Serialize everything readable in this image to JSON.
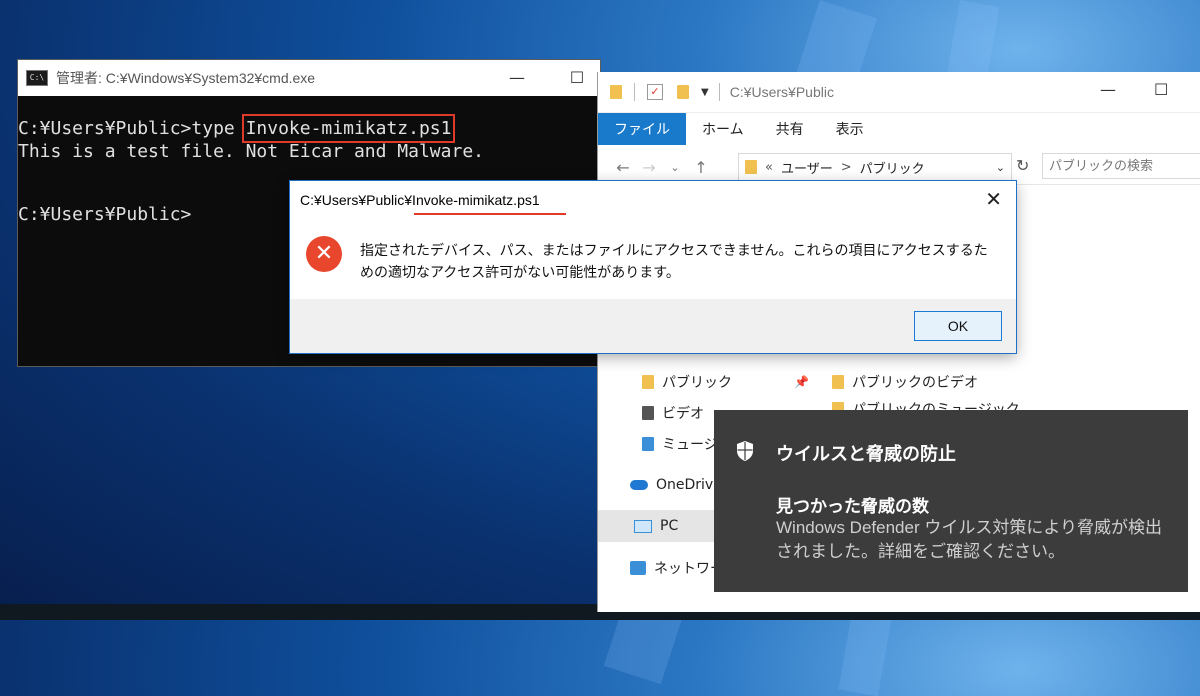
{
  "cmd": {
    "title": "管理者: C:¥Windows¥System32¥cmd.exe",
    "icon": "C:\\",
    "prompt1": "C:¥Users¥Public>type ",
    "command_arg": "Invoke-mimikatz.ps1",
    "output": "This is a test file. Not Eicar and Malware.",
    "prompt2": "C:¥Users¥Public>"
  },
  "explorer": {
    "title": "C:¥Users¥Public",
    "tabs": [
      "ファイル",
      "ホーム",
      "共有",
      "表示"
    ],
    "address": [
      "«",
      "ユーザー",
      ">",
      "パブリック"
    ],
    "search_placeholder": "パブリックの検索",
    "nav_items": [
      {
        "label": "パブリック"
      },
      {
        "label": "ビデオ"
      },
      {
        "label": "ミュージッ"
      },
      {
        "label": "OneDrive"
      },
      {
        "label": "PC"
      },
      {
        "label": "ネットワーク"
      }
    ],
    "content_items": [
      "パブリックのビデオ",
      "パブリックのミュージック"
    ]
  },
  "dialog": {
    "title": "C:¥Users¥Public¥Invoke-mimikatz.ps1",
    "message": "指定されたデバイス、パス、またはファイルにアクセスできません。これらの項目にアクセスするための適切なアクセス許可がない可能性があります。",
    "ok_label": "OK"
  },
  "toast": {
    "title": "ウイルスと脅威の防止",
    "heading": "見つかった脅威の数",
    "body": "Windows Defender ウイルス対策により脅威が検出されました。詳細をご確認ください。"
  },
  "colors": {
    "accent": "#1979ca",
    "error": "#e8472d",
    "highlight": "#e23a2a",
    "toast_bg": "#3c3c3c"
  }
}
